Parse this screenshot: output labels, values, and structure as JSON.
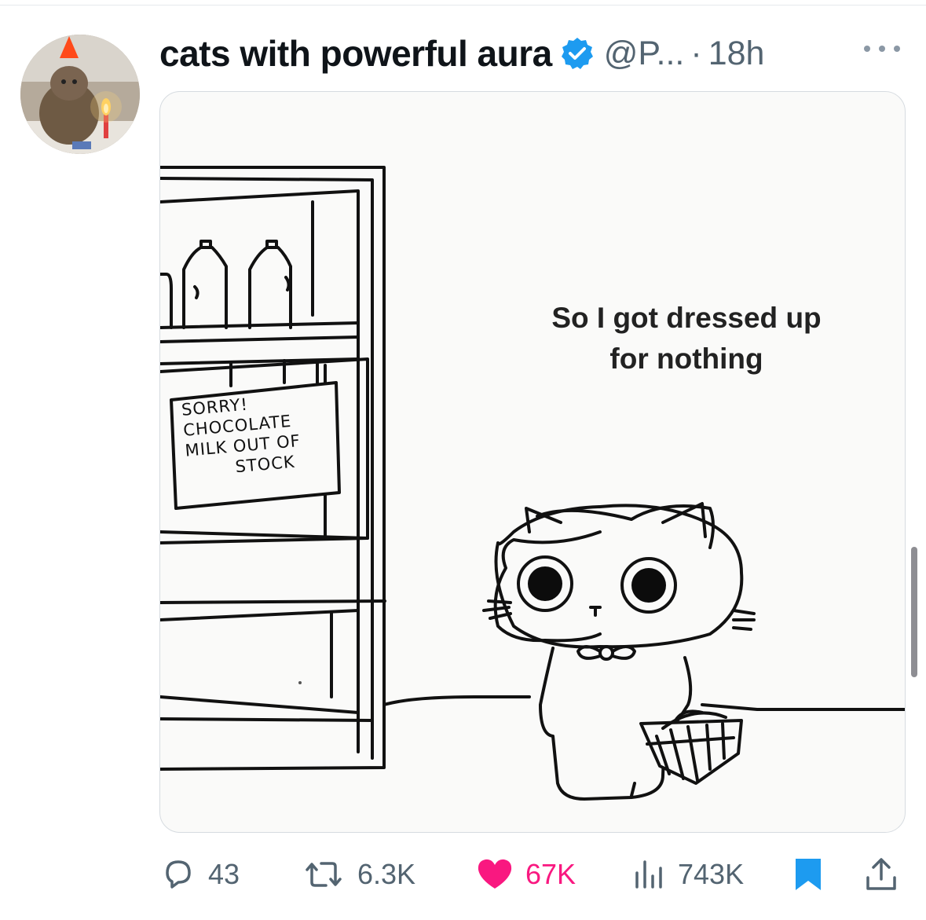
{
  "tweet": {
    "author_name": "cats with powerful aura",
    "handle": "@P...",
    "separator": "·",
    "time": "18h",
    "verified": true,
    "avatar_icon": "cat-with-party-hat-and-candle",
    "more_icon": "more-options-icon"
  },
  "media": {
    "caption_line1": "So I got dressed up",
    "caption_line2": "for nothing",
    "sign": {
      "line1": "SORRY!",
      "line2": "CHOCOLATE",
      "line3": "MILK OUT OF",
      "line4": "STOCK"
    }
  },
  "actions": {
    "replies": "43",
    "retweets": "6.3K",
    "likes": "67K",
    "views": "743K",
    "bookmark_icon": "bookmark-icon",
    "share_icon": "share-icon"
  },
  "colors": {
    "like": "#f91880",
    "verified": "#1d9bf0",
    "bookmark": "#1d9bf0",
    "muted": "#536471"
  }
}
